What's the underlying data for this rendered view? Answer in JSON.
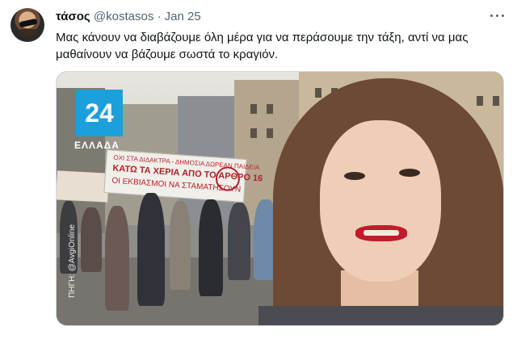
{
  "tweet": {
    "avatar_alt": "profile avatar",
    "name": "τάσος",
    "handle": "@kostasos",
    "separator": "·",
    "date": "Jan 25",
    "text": "Μας κάνουν να διαβάζουμε όλη μέρα για να περάσουμε την τάξη, αντί να μας μαθαίνουν να βάζουμε σωστά το κραγιόν.",
    "more_icon": "more-horizontal-icon"
  },
  "media": {
    "logo_number": "24",
    "logo_region": "ΕΛΛΑΔΑ",
    "source_watermark": "ΠΗΓΗ: @AvgiOnline",
    "banner_line1": "ΟΧΙ ΣΤΑ ΔΙΔΑΚΤΡΑ - ΔΗΜΟΣΙΑ ΔΩΡΕΑΝ ΠΑΙΔΕΙΑ",
    "banner_line2": "ΚΑΤΩ ΤΑ ΧΕΡΙΑ ΑΠΟ ΤΟ ΑΡΘΡΟ 16",
    "banner_line3": "ΟΙ ΕΚΒΙΑΣΜΟΙ ΝΑ ΣΤΑΜΑΤΗΣΟΥΝ"
  },
  "colors": {
    "text_primary": "#0f1419",
    "text_secondary": "#536471",
    "border": "#cfd9de",
    "logo_blue": "#1ca0dc",
    "lipstick_red": "#c01c2a"
  }
}
